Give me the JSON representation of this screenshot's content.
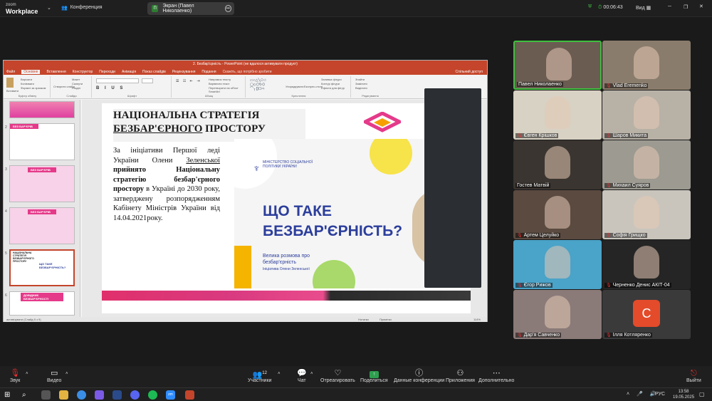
{
  "zoom": {
    "logo_top": "zoom",
    "logo_bottom": "Workplace",
    "conference_label": "Конференция",
    "share_badge": "П",
    "share_label": "Экран (Павел Николаенко)",
    "timer": "00:06:43",
    "view_label": "Вид"
  },
  "ppt": {
    "window_title": "2. Безбар'єрність - PowerPoint (не вдалося активувати продукт)",
    "tabs": [
      "Файл",
      "Основне",
      "Вставлення",
      "Конструктор",
      "Переходи",
      "Анімація",
      "Показ слайдів",
      "Рецензування",
      "Подання"
    ],
    "active_tab": "Основне",
    "search_hint": "Скажіть, що потрібно зробити",
    "share_btn": "Спільний доступ",
    "ribbon_groups": [
      "Буфер обміну",
      "Слайди",
      "Шрифт",
      "Абзац",
      "Креслення",
      "Редагування"
    ],
    "ribbon_items": [
      "Вставити",
      "Вирізати",
      "Копіювати",
      "Формат за зразком",
      "Створити слайд",
      "Макет",
      "Скинути",
      "Розділ",
      "Напрямок тексту",
      "Вирівняти текст",
      "Перетворити на об'єкт SmartArt",
      "Упорядкувати",
      "Експрес-стилі",
      "Заливка фігури",
      "Контур фігури",
      "Ефекти для фігур",
      "Знайти",
      "Замінити",
      "Виділити"
    ],
    "status_left": "активізувати (Слайд 5 з 9)",
    "status_items": [
      "Нотатки",
      "Примітки",
      "114%"
    ],
    "thumb_texts": [
      "БЕЗ БАР'ЄРІВ",
      "БЕЗ БАР'ЄРІВ",
      "БЕЗ БАР'ЄРІВ",
      "НАЦІОНАЛЬНА СТРАТЕГІЯ БЕЗБАР'ЄРНОГО ПРОСТОРУ",
      "ЩО ТАКЕ БЕЗБАР'ЄРНІСТЬ?",
      "ДОВІДНИК БЕЗБАР'ЄРНОСТІ"
    ],
    "thumb_nums": [
      "2",
      "3",
      "4",
      "5",
      "6"
    ]
  },
  "slide": {
    "title_line1": "НАЦІОНАЛЬНА СТРАТЕГІЯ",
    "title_line2_underlined": "БЕЗБАР'ЄРНОГО",
    "title_line2_rest": " ПРОСТОРУ",
    "body_p1": "За ініціативи Першої леді України Олени ",
    "body_name": "Зеленської",
    "body_bold": " прийнято Національну стратегію безбар'єрного простору",
    "body_p2": " в Україні до 2030 року, затверджену розпорядженням Кабінету Міністрів України від 14.04.2021року.",
    "promo_ministry": "МІНІСТЕРСТВО СОЦІАЛЬНОЇ ПОЛІТИКИ УКРАЇНИ",
    "promo_title_1": "ЩО ТАКЕ",
    "promo_title_2": "БЕЗБАР'ЄРНІСТЬ?",
    "promo_sub_1": "Велика розмова про",
    "promo_sub_2": "безбар'єрність",
    "promo_sub_3": "Ініціатива Олени Зеленської"
  },
  "participants": [
    {
      "name": "Павел Николаенко",
      "muted": false,
      "speaking": true,
      "bg": "#6b5c52"
    },
    {
      "name": "Vlad Eremenko",
      "muted": true,
      "speaking": false,
      "bg": "#8a7c6c"
    },
    {
      "name": "Євген Крішков",
      "muted": true,
      "speaking": false,
      "bg": "#d8d2c4"
    },
    {
      "name": "Шаров Микита",
      "muted": true,
      "speaking": false,
      "bg": "#b8b1a6"
    },
    {
      "name": "Гостев Матвій",
      "muted": false,
      "speaking": false,
      "bg": "#3a3530"
    },
    {
      "name": "Михаил Суяров",
      "muted": true,
      "speaking": false,
      "bg": "#9c9a91"
    },
    {
      "name": "Артем Целуйко",
      "muted": true,
      "speaking": false,
      "bg": "#5a4a40"
    },
    {
      "name": "Софія Грищко",
      "muted": true,
      "speaking": false,
      "bg": "#c9c5bd"
    },
    {
      "name": "Єгор Рижов",
      "muted": true,
      "speaking": false,
      "bg": "#4aa3c8"
    },
    {
      "name": "Черненко Денис АКІТ-04",
      "muted": true,
      "speaking": false,
      "bg": "#252525"
    },
    {
      "name": "Дар'я Савченко",
      "muted": true,
      "speaking": false,
      "bg": "#8a7a78"
    },
    {
      "name": "Ілля Котляренко",
      "muted": true,
      "speaking": false,
      "bg": "#3a3a3a",
      "avatar": "С"
    }
  ],
  "toolbar": {
    "mute_label": "Звук",
    "video_label": "Видео",
    "participants_label": "Участники",
    "participants_count": "12",
    "chat_label": "Чат",
    "react_label": "Отреагировать",
    "share_label": "Поделиться",
    "info_label": "Данные конференции",
    "apps_label": "Приложения",
    "more_label": "Дополнительно",
    "leave_label": "Выйти"
  },
  "taskbar": {
    "lang": "РУС",
    "time": "13:58",
    "date": "19.05.2025"
  },
  "colors": {
    "ppt_accent": "#c4452b",
    "speaker_border": "#3fbf3f",
    "promo_blue": "#2c3e9c"
  }
}
